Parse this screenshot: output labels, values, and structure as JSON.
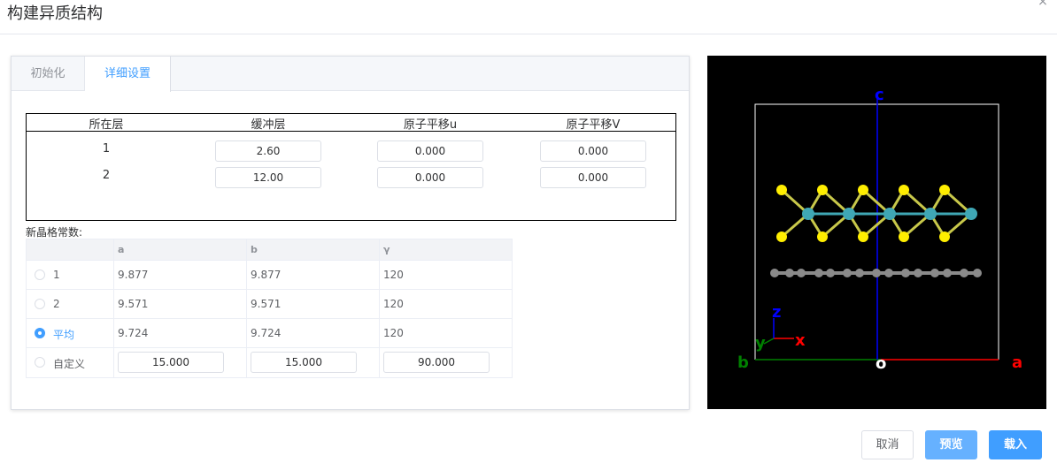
{
  "dialog": {
    "title": "构建异质结构",
    "close_glyph": "×"
  },
  "tabs": [
    {
      "label": "初始化",
      "active": false
    },
    {
      "label": "详细设置",
      "active": true
    }
  ],
  "layer_table": {
    "headers": [
      "所在层",
      "缓冲层",
      "原子平移u",
      "原子平移V"
    ],
    "rows": [
      {
        "layer": "1",
        "buffer": "2.60",
        "shift_u": "0.000",
        "shift_v": "0.000"
      },
      {
        "layer": "2",
        "buffer": "12.00",
        "shift_u": "0.000",
        "shift_v": "0.000"
      }
    ]
  },
  "lattice": {
    "label": "新晶格常数:",
    "headers": [
      "a",
      "b",
      "γ"
    ],
    "rows": [
      {
        "option": "1",
        "a": "9.877",
        "b": "9.877",
        "gamma": "120",
        "checked": false
      },
      {
        "option": "2",
        "a": "9.571",
        "b": "9.571",
        "gamma": "120",
        "checked": false
      },
      {
        "option": "平均",
        "a": "9.724",
        "b": "9.724",
        "gamma": "120",
        "checked": true
      },
      {
        "option": "自定义",
        "a": "15.000",
        "b": "15.000",
        "gamma": "90.000",
        "checked": false
      }
    ]
  },
  "viewer": {
    "axis_labels": {
      "c": "c",
      "a": "a",
      "b": "b",
      "origin": "o",
      "x": "x",
      "y": "y",
      "z": "z"
    },
    "colors": {
      "background": "#000000",
      "sulfur": "#ffee00",
      "metal": "#3fa7b5",
      "carbon": "#8a8a8a",
      "c_axis": "#0000ff",
      "a_axis": "#ff0000",
      "b_axis": "#008000",
      "cell": "#ffffff"
    }
  },
  "buttons": {
    "cancel": "取消",
    "preview": "预览",
    "load": "载入"
  },
  "colors": {
    "accent": "#409eff",
    "accent_light": "#66b1ff"
  }
}
